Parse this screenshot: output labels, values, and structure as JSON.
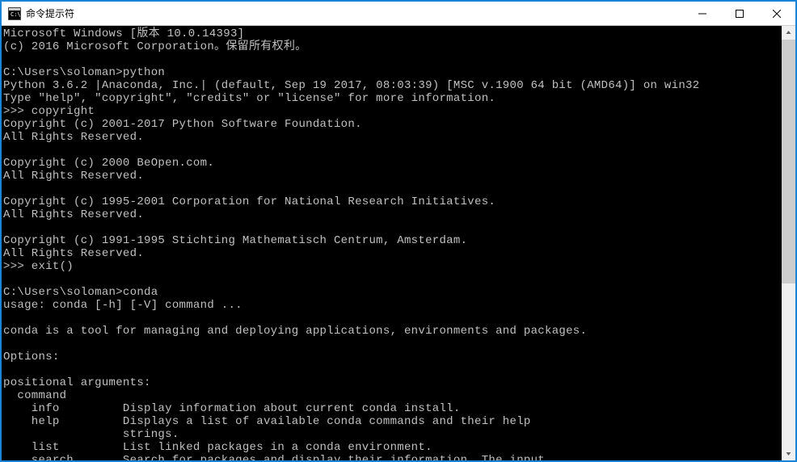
{
  "window": {
    "title": "命令提示符"
  },
  "terminal": {
    "lines": [
      "Microsoft Windows [版本 10.0.14393]",
      "(c) 2016 Microsoft Corporation。保留所有权利。",
      "",
      "C:\\Users\\soloman>python",
      "Python 3.6.2 |Anaconda, Inc.| (default, Sep 19 2017, 08:03:39) [MSC v.1900 64 bit (AMD64)] on win32",
      "Type \"help\", \"copyright\", \"credits\" or \"license\" for more information.",
      ">>> copyright",
      "Copyright (c) 2001-2017 Python Software Foundation.",
      "All Rights Reserved.",
      "",
      "Copyright (c) 2000 BeOpen.com.",
      "All Rights Reserved.",
      "",
      "Copyright (c) 1995-2001 Corporation for National Research Initiatives.",
      "All Rights Reserved.",
      "",
      "Copyright (c) 1991-1995 Stichting Mathematisch Centrum, Amsterdam.",
      "All Rights Reserved.",
      ">>> exit()",
      "",
      "C:\\Users\\soloman>conda",
      "usage: conda [-h] [-V] command ...",
      "",
      "conda is a tool for managing and deploying applications, environments and packages.",
      "",
      "Options:",
      "",
      "positional arguments:",
      "  command",
      "    info         Display information about current conda install.",
      "    help         Displays a list of available conda commands and their help",
      "                 strings.",
      "    list         List linked packages in a conda environment.",
      "    search       Search for packages and display their information. The input"
    ]
  }
}
